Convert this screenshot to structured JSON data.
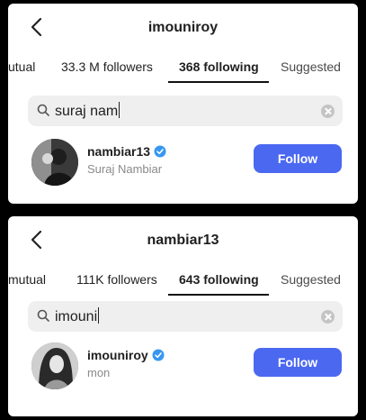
{
  "colors": {
    "follow_button": "#4b68f1",
    "verified_badge": "#3797f0",
    "background": "#000000",
    "panel": "#ffffff"
  },
  "icons": [
    "chevron-left-icon",
    "search-icon",
    "clear-icon",
    "verified-badge-icon"
  ],
  "panels": [
    {
      "header": {
        "title": "imouniroy"
      },
      "tabs": [
        "utual",
        "33.3 M followers",
        "368 following",
        "Suggested"
      ],
      "active_tab": "368 following",
      "search": {
        "value": "suraj nam"
      },
      "result": {
        "username": "nambiar13",
        "verified": true,
        "full_name": "Suraj Nambiar",
        "button_label": "Follow"
      }
    },
    {
      "header": {
        "title": "nambiar13"
      },
      "tabs": [
        "mutual",
        "111K followers",
        "643 following",
        "Suggested"
      ],
      "active_tab": "643 following",
      "search": {
        "value": "imouni"
      },
      "result": {
        "username": "imouniroy",
        "verified": true,
        "full_name": "mon",
        "button_label": "Follow"
      }
    }
  ]
}
